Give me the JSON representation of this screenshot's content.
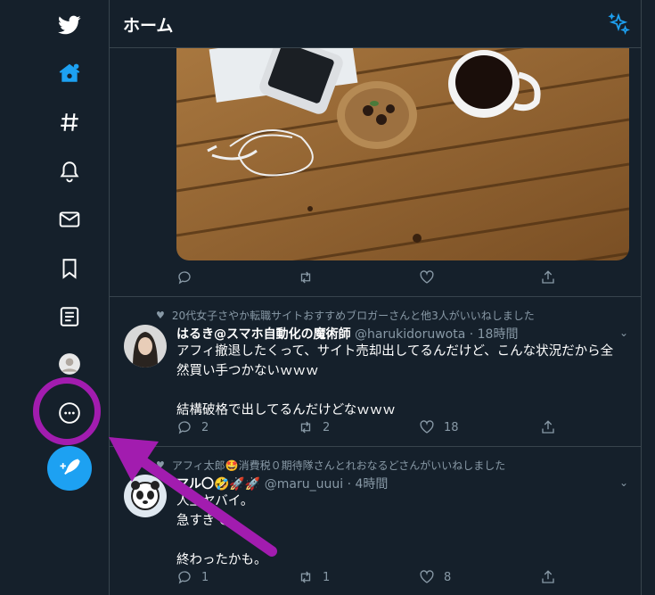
{
  "colors": {
    "accent": "#1da1f2",
    "background": "#15202b",
    "muted": "#8899a6",
    "annotation": "#a21caf"
  },
  "sidebar": {
    "items": [
      {
        "icon": "twitter-logo-icon"
      },
      {
        "icon": "home-icon"
      },
      {
        "icon": "explore-hashtag-icon"
      },
      {
        "icon": "notifications-bell-icon"
      },
      {
        "icon": "messages-envelope-icon"
      },
      {
        "icon": "bookmarks-icon"
      },
      {
        "icon": "lists-icon"
      },
      {
        "icon": "profile-avatar-icon"
      },
      {
        "icon": "more-icon"
      }
    ],
    "compose_icon": "compose-tweet-icon"
  },
  "header": {
    "title": "ホーム",
    "icon": "sparkle-icon"
  },
  "tweets": [
    {
      "media": "photo-desk-coffee-phone",
      "actions": {
        "reply": "",
        "retweet": "",
        "like": ""
      }
    },
    {
      "social_context": "20代女子さやか転職サイトおすすめブロガーさんと他3人がいいねしました",
      "display_name": "はるき@スマホ自動化の魔術師",
      "handle": "@harukidoruwota",
      "time": "· 18時間",
      "text_line1": "アフィ撤退したくって、サイト売却出してるんだけど、こんな状況だから全",
      "text_line2": "然買い手つかないｗｗｗ",
      "text_line3": "結構破格で出してるんだけどなｗｗｗ",
      "actions": {
        "reply": "2",
        "retweet": "2",
        "like": "18"
      }
    },
    {
      "social_context": "アフィ太郎🤩消費税０期待隊さんとれおなるどさんがいいねしました",
      "display_name": "マル〇🤣🚀🚀",
      "handle": "@maru_uuui",
      "time": "· 4時間",
      "text_line1": "人生ヤバイ。",
      "text_line2": "急すぎて。",
      "text_line3": "終わったかも。",
      "actions": {
        "reply": "1",
        "retweet": "1",
        "like": "8"
      }
    }
  ]
}
